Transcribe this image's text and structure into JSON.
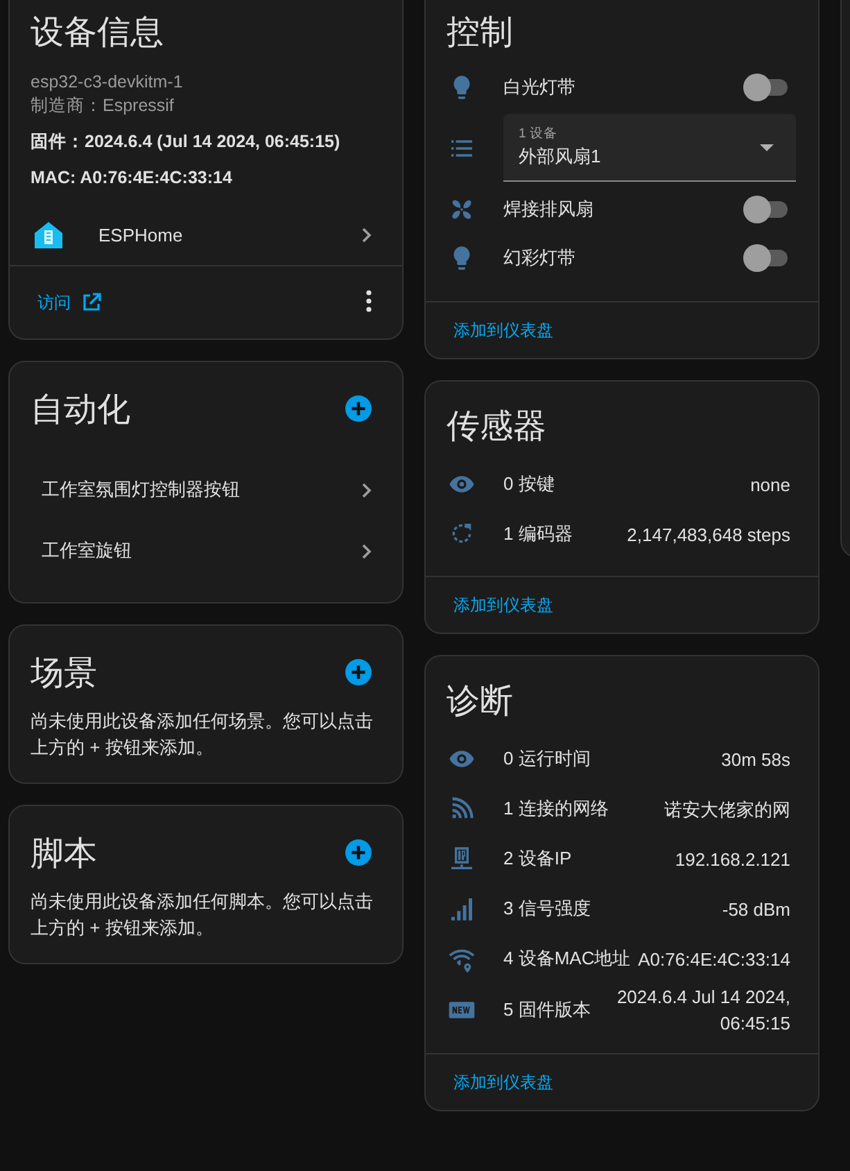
{
  "device_info": {
    "title": "设备信息",
    "model": "esp32-c3-devkitm-1",
    "manufacturer": "制造商：Espressif",
    "firmware": "固件：2024.6.4 (Jul 14 2024, 06:45:15)",
    "mac": "MAC: A0:76:4E:4C:33:14",
    "integration": "ESPHome",
    "visit_link": "访问"
  },
  "automations": {
    "title": "自动化",
    "items": [
      "工作室氛围灯控制器按钮",
      "工作室旋钮"
    ]
  },
  "scenes": {
    "title": "场景",
    "empty_text": "尚未使用此设备添加任何场景。您可以点击上方的 + 按钮来添加。"
  },
  "scripts": {
    "title": "脚本",
    "empty_text": "尚未使用此设备添加任何脚本。您可以点击上方的 + 按钮来添加。"
  },
  "controls": {
    "title": "控制",
    "items": [
      {
        "kind": "switch",
        "label": "白光灯带",
        "on": false
      },
      {
        "kind": "select",
        "label": "1 设备",
        "value": "外部风扇1"
      },
      {
        "kind": "switch",
        "label": "焊接排风扇",
        "on": false
      },
      {
        "kind": "switch",
        "label": "幻彩灯带",
        "on": false
      }
    ],
    "add_link": "添加到仪表盘"
  },
  "sensors": {
    "title": "传感器",
    "items": [
      {
        "name": "0 按键",
        "value": "none"
      },
      {
        "name": "1 编码器",
        "value": "2,147,483,648 steps"
      }
    ],
    "add_link": "添加到仪表盘"
  },
  "diagnostics": {
    "title": "诊断",
    "items": [
      {
        "name": "0 运行时间",
        "value": "30m 58s"
      },
      {
        "name": "1 连接的网络",
        "value": "诺安大佬家的网"
      },
      {
        "name": "2 设备IP",
        "value": "192.168.2.121"
      },
      {
        "name": "3 信号强度",
        "value": "-58 dBm"
      },
      {
        "name": "4 设备MAC地址",
        "value": "A0:76:4E:4C:33:14"
      },
      {
        "name": "5 固件版本",
        "value": "2024.6.4 Jul 14 2024, 06:45:15"
      }
    ],
    "add_link": "添加到仪表盘"
  }
}
